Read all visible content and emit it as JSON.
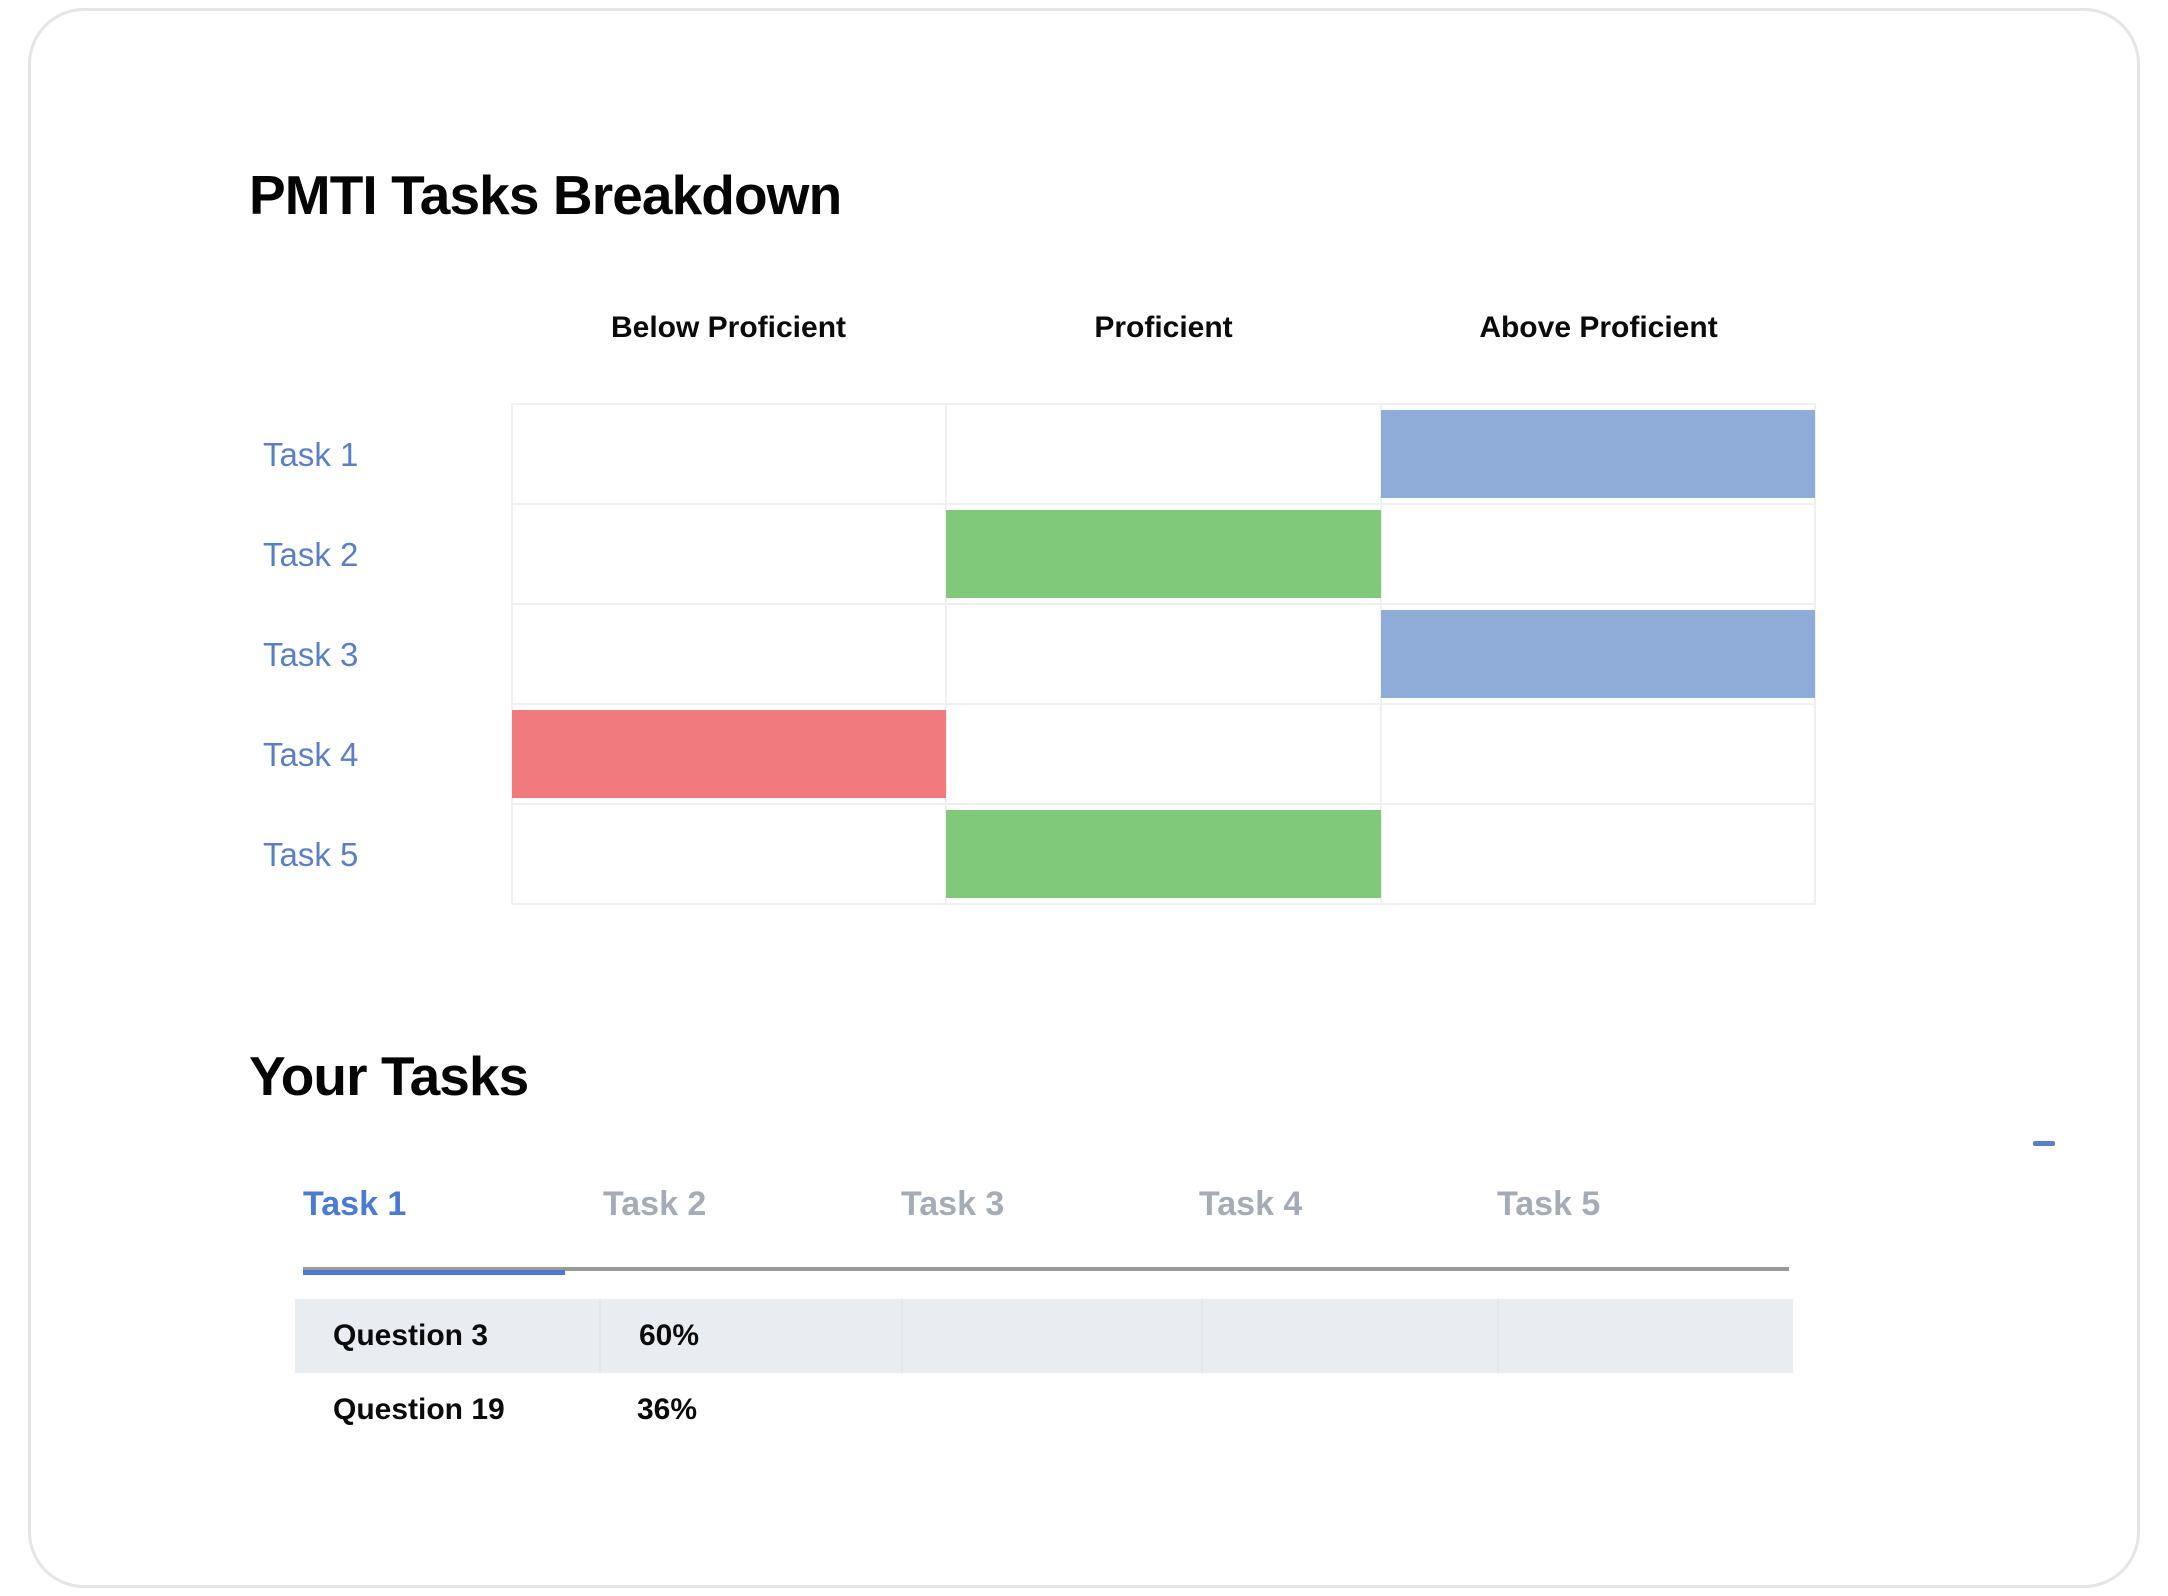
{
  "breakdown": {
    "title": "PMTI Tasks Breakdown",
    "columns": [
      "Below Proficient",
      "Proficient",
      "Above Proficient"
    ],
    "rows": [
      {
        "label": "Task 1",
        "level": "Above Proficient",
        "color_index": 2
      },
      {
        "label": "Task 2",
        "level": "Proficient",
        "color_index": 1
      },
      {
        "label": "Task 3",
        "level": "Above Proficient",
        "color_index": 2
      },
      {
        "label": "Task 4",
        "level": "Below Proficient",
        "color_index": 0
      },
      {
        "label": "Task 5",
        "level": "Proficient",
        "color_index": 1
      }
    ],
    "colors": {
      "below_proficient": "#f07a7e",
      "proficient": "#81c97a",
      "above_proficient": "#8fabd8",
      "row_label": "#5b7fc4",
      "gridline": "#f0f0f1"
    }
  },
  "your_tasks": {
    "title": "Your Tasks",
    "tabs": [
      {
        "label": "Task 1",
        "active": true
      },
      {
        "label": "Task 2",
        "active": false
      },
      {
        "label": "Task 3",
        "active": false
      },
      {
        "label": "Task 4",
        "active": false
      },
      {
        "label": "Task 5",
        "active": false
      }
    ],
    "active_tab_color": "#4a7ad1",
    "inactive_tab_color": "#a6acb5",
    "table": {
      "rows": [
        {
          "cells": [
            "Question 3",
            "60%",
            "",
            "",
            ""
          ],
          "shaded": true
        },
        {
          "cells": [
            "Question 19",
            "36%",
            "",
            "",
            ""
          ],
          "shaded": false
        }
      ]
    },
    "right_marker": "dash-marker"
  },
  "chart_data": {
    "type": "heatmap",
    "title": "PMTI Tasks Breakdown",
    "categories": [
      "Below Proficient",
      "Proficient",
      "Above Proficient"
    ],
    "rows": [
      "Task 1",
      "Task 2",
      "Task 3",
      "Task 4",
      "Task 5"
    ],
    "values": [
      [
        0,
        0,
        1
      ],
      [
        0,
        1,
        0
      ],
      [
        0,
        0,
        1
      ],
      [
        1,
        0,
        0
      ],
      [
        0,
        1,
        0
      ]
    ],
    "xlabel": "",
    "ylabel": "",
    "grid": true,
    "legend": "none"
  }
}
